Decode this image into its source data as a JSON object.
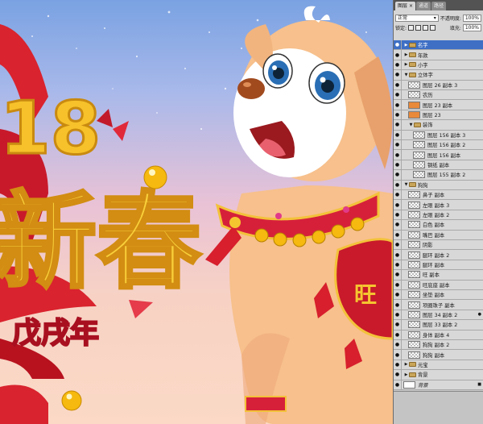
{
  "canvas": {
    "headline_characters": "新春",
    "subtitle": "戊戌年",
    "year_fragment": "18"
  },
  "panel": {
    "tabs": [
      {
        "label": "图层",
        "active": true
      },
      {
        "label": "通道",
        "active": false
      },
      {
        "label": "路径",
        "active": false
      }
    ],
    "blend_mode": "正常",
    "opacity_label": "不透明度:",
    "opacity_value": "100%",
    "lock_label": "锁定:",
    "fill_label": "填充:",
    "fill_value": "100%"
  },
  "layers": [
    {
      "name": "名字",
      "type": "folder",
      "depth": 0,
      "expanded": false,
      "selected": true
    },
    {
      "name": "年款",
      "type": "folder",
      "depth": 0,
      "expanded": false
    },
    {
      "name": "小字",
      "type": "folder",
      "depth": 0,
      "expanded": false
    },
    {
      "name": "立体字",
      "type": "folder",
      "depth": 0,
      "expanded": true
    },
    {
      "name": "图层 26 副本 3",
      "type": "layer",
      "depth": 1,
      "thumb": "checker"
    },
    {
      "name": "农历",
      "type": "layer",
      "depth": 1,
      "thumb": "checker"
    },
    {
      "name": "图层 23 副本",
      "type": "layer",
      "depth": 1,
      "thumb": "orange"
    },
    {
      "name": "图层 23",
      "type": "layer",
      "depth": 1,
      "thumb": "orange"
    },
    {
      "name": "装饰",
      "type": "folder",
      "depth": 1,
      "expanded": true
    },
    {
      "name": "图层 156 副本 3",
      "type": "layer",
      "depth": 2,
      "thumb": "checker"
    },
    {
      "name": "图层 156 副本 2",
      "type": "layer",
      "depth": 2,
      "thumb": "checker"
    },
    {
      "name": "图层 156 副本",
      "type": "layer",
      "depth": 2,
      "thumb": "checker"
    },
    {
      "name": "钢纸 副本",
      "type": "layer",
      "depth": 2,
      "thumb": "checker"
    },
    {
      "name": "图层 155 副本 2",
      "type": "layer",
      "depth": 2,
      "thumb": "checker"
    },
    {
      "name": "狗狗",
      "type": "folder",
      "depth": 0,
      "expanded": true
    },
    {
      "name": "鼻子 副本",
      "type": "layer",
      "depth": 1,
      "thumb": "checker"
    },
    {
      "name": "左眼 副本 3",
      "type": "layer",
      "depth": 1,
      "thumb": "checker"
    },
    {
      "name": "左眼 副本 2",
      "type": "layer",
      "depth": 1,
      "thumb": "checker"
    },
    {
      "name": "白色 副本",
      "type": "layer",
      "depth": 1,
      "thumb": "checker"
    },
    {
      "name": "嘴巴 副本",
      "type": "layer",
      "depth": 1,
      "thumb": "checker"
    },
    {
      "name": "阴影",
      "type": "layer",
      "depth": 1,
      "thumb": "checker"
    },
    {
      "name": "腿环 副本 2",
      "type": "layer",
      "depth": 1,
      "thumb": "checker"
    },
    {
      "name": "腿环 副本",
      "type": "layer",
      "depth": 1,
      "thumb": "checker"
    },
    {
      "name": "旺 副本",
      "type": "layer",
      "depth": 1,
      "thumb": "checker"
    },
    {
      "name": "旺底座 副本",
      "type": "layer",
      "depth": 1,
      "thumb": "checker"
    },
    {
      "name": "坐垫 副本",
      "type": "layer",
      "depth": 1,
      "thumb": "checker"
    },
    {
      "name": "项圈珠子 副本",
      "type": "layer",
      "depth": 1,
      "thumb": "checker"
    },
    {
      "name": "图层 34 副本 2",
      "type": "layer",
      "depth": 1,
      "thumb": "checker",
      "fx": true
    },
    {
      "name": "图层 33 副本 2",
      "type": "layer",
      "depth": 1,
      "thumb": "checker"
    },
    {
      "name": "身体 副本 4",
      "type": "layer",
      "depth": 1,
      "thumb": "checker"
    },
    {
      "name": "狗狗 副本 2",
      "type": "layer",
      "depth": 1,
      "thumb": "checker"
    },
    {
      "name": "狗狗 副本",
      "type": "layer",
      "depth": 1,
      "thumb": "checker"
    },
    {
      "name": "元宝",
      "type": "folder",
      "depth": 0,
      "expanded": false
    },
    {
      "name": "背景",
      "type": "folder",
      "depth": 0,
      "expanded": false
    },
    {
      "name": "背景",
      "type": "layer",
      "depth": 0,
      "thumb": "white",
      "locked": true
    }
  ]
}
